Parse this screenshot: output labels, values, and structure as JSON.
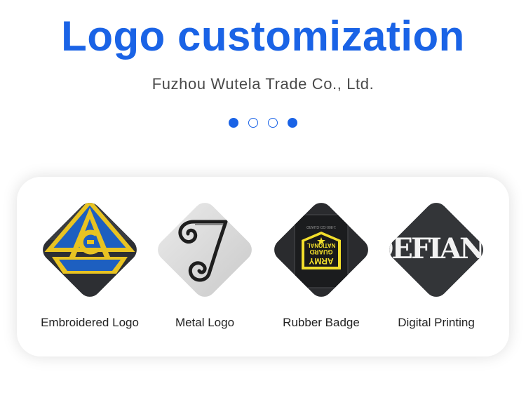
{
  "header": {
    "title": "Logo customization",
    "subtitle": "Fuzhou Wutela Trade Co., Ltd."
  },
  "carousel": {
    "dots": [
      true,
      false,
      false,
      true
    ]
  },
  "products": [
    {
      "label": "Embroidered Logo",
      "icon": "embroidered-compass-patch"
    },
    {
      "label": "Metal Logo",
      "icon": "metal-spiral-logo"
    },
    {
      "label": "Rubber Badge",
      "icon": "army-national-guard-rubber-patch",
      "badge_text": [
        "1-800-GO-GUARD",
        "NATIONAL",
        "GUARD",
        "ARMY"
      ]
    },
    {
      "label": "Digital Printing",
      "icon": "printed-lettering",
      "print_text": "DEFIANC"
    }
  ],
  "colors": {
    "accent": "#1a63e6",
    "badge_yellow": "#f2de2b"
  }
}
